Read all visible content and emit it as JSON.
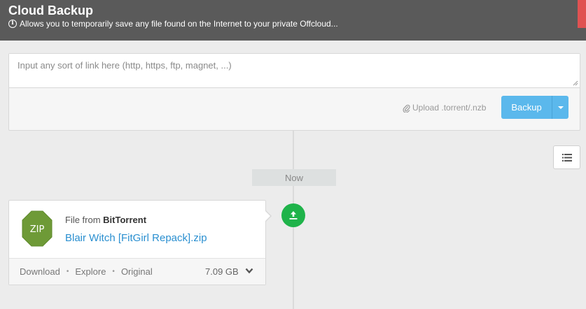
{
  "header": {
    "title": "Cloud Backup",
    "subtitle": "Allows you to temporarily save any file found on the Internet to your private Offcloud..."
  },
  "input_panel": {
    "link_placeholder": "Input any sort of link here (http, https, ftp, magnet, ...)",
    "link_value": "",
    "upload_label": "Upload .torrent/.nzb",
    "backup_label": "Backup"
  },
  "timeline": {
    "now_label": "Now"
  },
  "items": [
    {
      "source_prefix": "File from ",
      "source_name": "BitTorrent",
      "file_name": "Blair Witch [FitGirl Repack].zip",
      "file_type": "ZIP",
      "actions": [
        "Download",
        "Explore",
        "Original"
      ],
      "size": "7.09 GB"
    }
  ],
  "colors": {
    "header_bg": "#5a5a5a",
    "accent_blue": "#5bb8ec",
    "status_green": "#1fb34a",
    "zip_icon": "#6e9a37",
    "link_blue": "#2a8fd0"
  }
}
